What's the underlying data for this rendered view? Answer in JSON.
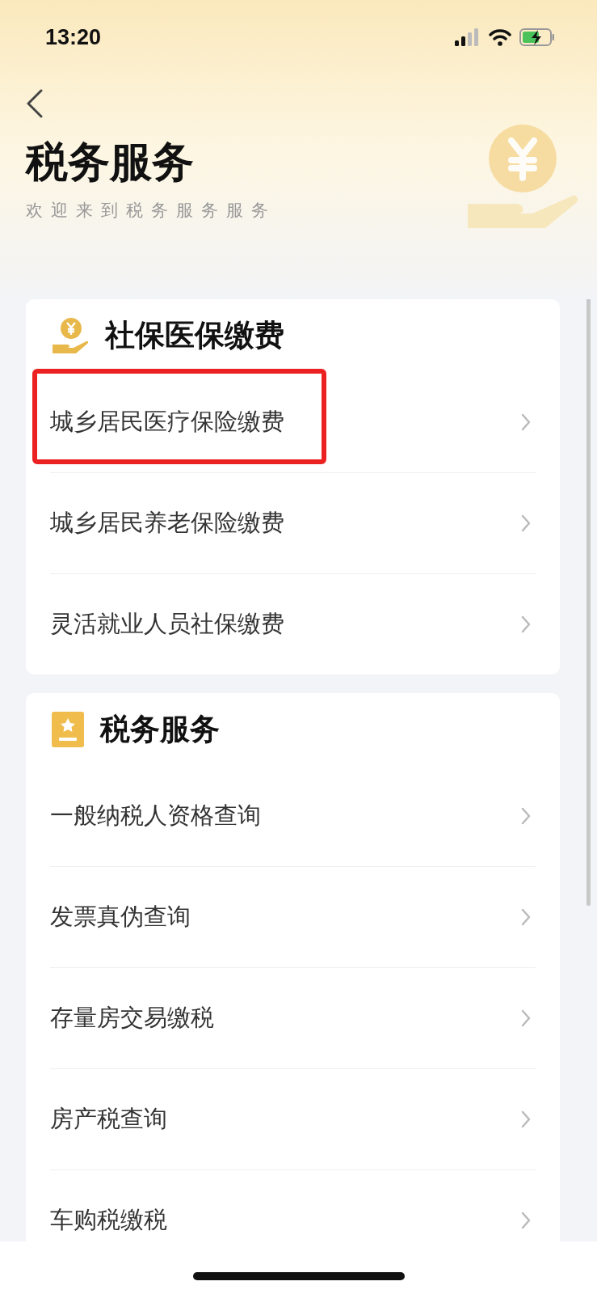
{
  "status_bar": {
    "time": "13:20"
  },
  "header": {
    "title": "税务服务",
    "subtitle": "欢迎来到税务服务服务"
  },
  "sections": [
    {
      "title": "社保医保缴费",
      "kind": "coin-hand",
      "items": [
        {
          "label": "城乡居民医疗保险缴费",
          "highlighted": true
        },
        {
          "label": "城乡居民养老保险缴费",
          "highlighted": false
        },
        {
          "label": "灵活就业人员社保缴费",
          "highlighted": false
        }
      ]
    },
    {
      "title": "税务服务",
      "kind": "badge",
      "items": [
        {
          "label": "一般纳税人资格查询",
          "highlighted": false
        },
        {
          "label": "发票真伪查询",
          "highlighted": false
        },
        {
          "label": "存量房交易缴税",
          "highlighted": false
        },
        {
          "label": "房产税查询",
          "highlighted": false
        },
        {
          "label": "车购税缴税",
          "highlighted": false
        }
      ]
    }
  ]
}
